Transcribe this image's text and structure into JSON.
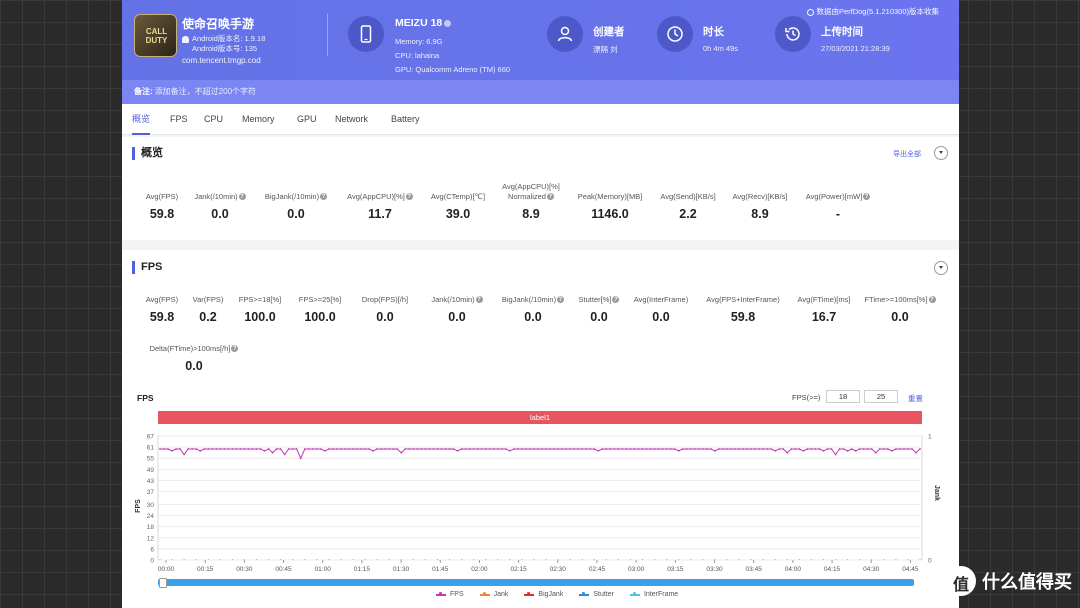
{
  "header": {
    "app_icon_text": "CALL DUTY",
    "app_name": "使命召唤手游",
    "android_version_name": "Android版本名: 1.9.18",
    "android_version_code": "Android版本号: 135",
    "package": "com.tencent.tmgp.cod",
    "device": {
      "name": "MEIZU 18",
      "memory": "Memory: 6.9G",
      "cpu": "CPU: lahaina",
      "gpu": "GPU: Qualcomm Adreno (TM) 660"
    },
    "creator": {
      "title": "创建者",
      "value": "漂隔 刘"
    },
    "duration": {
      "title": "时长",
      "value": "0h 4m 49s"
    },
    "upload": {
      "title": "上传时间",
      "value": "27/03/2021 21:28:39"
    },
    "version_note": "数据由PerfDog(5.1.210300)版本收集"
  },
  "note": {
    "label": "备注:",
    "placeholder": "添加备注，不超过200个字符"
  },
  "tabs": [
    "概览",
    "FPS",
    "CPU",
    "Memory",
    "GPU",
    "Network",
    "Battery"
  ],
  "overview": {
    "title": "概览",
    "export": "导出全部",
    "metrics": [
      {
        "label": "Avg(FPS)",
        "value": "59.8"
      },
      {
        "label": "Jank(/10min)",
        "value": "0.0"
      },
      {
        "label": "BigJank(/10min)",
        "value": "0.0"
      },
      {
        "label": "Avg(AppCPU)[%]",
        "value": "11.7"
      },
      {
        "label": "Avg(CTemp)[℃]",
        "value": "39.0"
      },
      {
        "label": "Avg(AppCPU)[%]",
        "label2": "Normalized",
        "value": "8.9"
      },
      {
        "label": "Peak(Memory)[MB]",
        "value": "1146.0"
      },
      {
        "label": "Avg(Send)[KB/s]",
        "value": "2.2"
      },
      {
        "label": "Avg(Recv)[KB/s]",
        "value": "8.9"
      },
      {
        "label": "Avg(Power)[mW]",
        "value": "-"
      }
    ]
  },
  "fps_section": {
    "title": "FPS",
    "metrics": [
      {
        "label": "Avg(FPS)",
        "value": "59.8"
      },
      {
        "label": "Var(FPS)",
        "value": "0.2"
      },
      {
        "label": "FPS>=18[%]",
        "value": "100.0"
      },
      {
        "label": "FPS>=25[%]",
        "value": "100.0"
      },
      {
        "label": "Drop(FPS)[/h]",
        "value": "0.0"
      },
      {
        "label": "Jank(/10min)",
        "value": "0.0"
      },
      {
        "label": "BigJank(/10min)",
        "value": "0.0"
      },
      {
        "label": "Stutter[%]",
        "value": "0.0"
      },
      {
        "label": "Avg(InterFrame)",
        "value": "0.0"
      },
      {
        "label": "Avg(FPS+InterFrame)",
        "value": "59.8"
      },
      {
        "label": "Avg(FTime)[ms]",
        "value": "16.7"
      },
      {
        "label": "FTime>=100ms[%]",
        "value": "0.0"
      },
      {
        "label": "Delta(FTime)>100ms[/h]",
        "value": "0.0"
      }
    ],
    "threshold_label": "FPS(>=)",
    "threshold_values": [
      "18",
      "25"
    ],
    "reset": "重置",
    "label_bar": "label1"
  },
  "chart_data": {
    "type": "line",
    "title": "FPS",
    "ylabel": "FPS",
    "y2label": "Jank",
    "yticks": [
      0,
      6,
      12,
      18,
      24,
      30,
      37,
      43,
      49,
      55,
      61,
      67
    ],
    "ylim": [
      0,
      67
    ],
    "y2ticks": [
      0,
      1
    ],
    "xticks": [
      "00:00",
      "00:15",
      "00:30",
      "00:45",
      "01:00",
      "01:15",
      "01:30",
      "01:45",
      "02:00",
      "02:15",
      "02:30",
      "02:45",
      "03:00",
      "03:15",
      "03:30",
      "03:45",
      "04:00",
      "04:15",
      "04:30",
      "04:45"
    ],
    "series": [
      {
        "name": "FPS",
        "color": "#c239b3",
        "values": [
          60,
          60,
          60,
          59,
          60,
          60,
          57,
          60,
          60,
          60,
          59,
          60,
          60,
          60,
          60,
          60,
          60,
          60,
          60,
          60,
          60,
          60,
          60,
          60,
          60,
          60,
          59,
          60,
          58,
          60,
          60,
          57,
          60,
          60,
          60,
          55,
          60,
          60,
          60,
          60,
          60,
          59,
          60,
          60,
          60,
          60,
          60,
          60,
          60,
          60,
          60,
          60,
          60,
          59,
          60,
          60,
          60,
          60,
          60,
          60,
          58,
          60,
          60,
          60,
          60,
          60,
          60,
          60,
          60,
          60,
          60,
          60,
          60,
          60,
          59,
          60,
          60,
          60,
          60,
          60,
          60,
          60,
          60,
          60,
          60,
          60,
          60,
          59,
          60,
          60,
          60,
          60,
          60,
          60,
          60,
          60,
          60,
          60,
          60,
          60,
          60,
          60,
          60,
          60,
          60,
          60,
          60,
          60,
          60,
          59,
          60,
          60,
          60,
          60,
          60,
          60,
          60,
          60,
          60,
          60,
          60,
          60,
          60,
          60,
          60,
          60,
          60,
          60,
          60,
          59,
          60,
          60,
          60,
          60,
          60,
          60,
          60,
          60,
          59,
          60,
          60,
          60,
          60,
          60,
          60,
          60,
          60,
          60,
          60,
          60,
          60,
          60,
          60,
          59,
          60,
          60,
          58,
          60,
          60,
          60,
          59,
          60,
          60,
          60,
          60,
          59,
          60,
          60,
          57,
          60,
          60,
          59,
          60,
          59,
          60,
          60,
          60,
          60,
          58,
          60,
          60,
          60,
          59,
          60,
          60,
          60,
          60,
          60,
          58,
          60
        ]
      },
      {
        "name": "Jank",
        "color": "#f08040",
        "values": []
      },
      {
        "name": "BigJank",
        "color": "#e03030",
        "values": []
      },
      {
        "name": "Stutter",
        "color": "#2a8fd8",
        "values": []
      },
      {
        "name": "InterFrame",
        "color": "#4fc3e0",
        "values": []
      }
    ]
  },
  "watermark": "什么值得买"
}
